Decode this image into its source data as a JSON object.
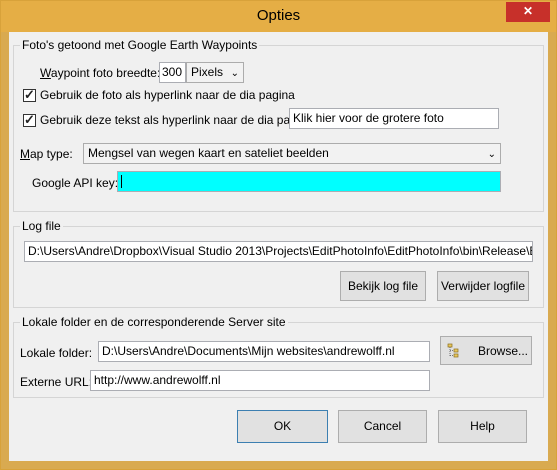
{
  "window": {
    "title": "Opties",
    "close_glyph": "✕"
  },
  "earth": {
    "group_title": "Foto's getoond met Google Earth Waypoints",
    "waypoint_label_u": "W",
    "waypoint_label_rest": "aypoint foto breedte:",
    "waypoint_value": "300",
    "unit_value": "Pixels",
    "check1_label": "Gebruik de foto als hyperlink naar de dia pagina",
    "check1_checked": true,
    "check2_label": "Gebruik deze tekst als hyperlink naar de dia pagina:",
    "check2_checked": true,
    "hyperlink_text": "Klik hier voor de grotere foto",
    "maptype_label_u": "M",
    "maptype_label_rest": "ap type:",
    "maptype_value": "Mengsel van wegen kaart en sateliet beelden",
    "apikey_label": "Google API key:",
    "apikey_color": "#00ffff",
    "check_glyph": "✓",
    "caret_glyph": "⌄"
  },
  "log": {
    "group_title": "Log file",
    "path": "D:\\Users\\Andre\\Dropbox\\Visual Studio 2013\\Projects\\EditPhotoInfo\\EditPhotoInfo\\bin\\Release\\EditPh",
    "view_label": "Bekijk log file",
    "remove_label": "Verwijder logfile"
  },
  "local": {
    "group_title": "Lokale folder en de corresponderende Server site",
    "folder_label": "Lokale folder:",
    "folder_value": "D:\\Users\\Andre\\Documents\\Mijn websites\\andrewolff.nl",
    "browse_label": "Browse...",
    "url_label": "Externe URL:",
    "url_value": "http://www.andrewolff.nl"
  },
  "buttons": {
    "ok": "OK",
    "cancel": "Cancel",
    "help": "Help"
  },
  "colors": {
    "titlebar": "#e5ae45",
    "close": "#c7302a",
    "client": "#f0f0f0"
  }
}
